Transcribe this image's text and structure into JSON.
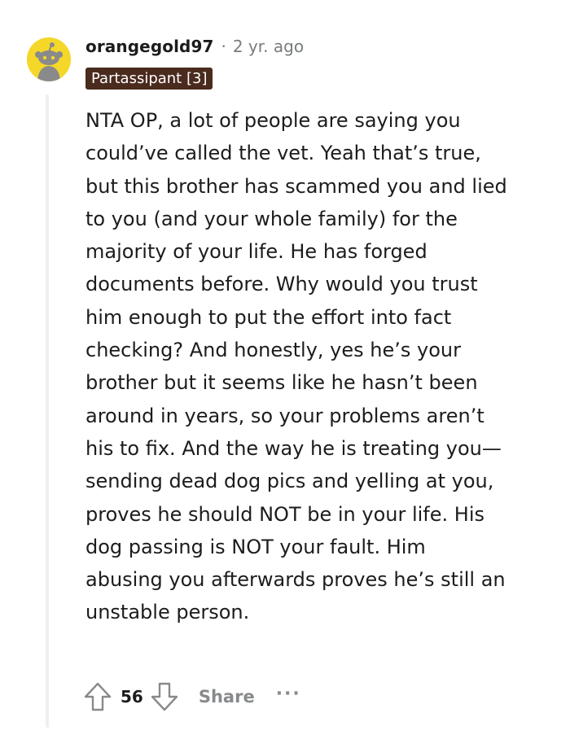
{
  "comment": {
    "username": "orangegold97",
    "separator": "·",
    "timestamp": "2 yr. ago",
    "flair": "Partassipant [3]",
    "body": "NTA OP, a lot of people are saying you could’ve called the vet. Yeah that’s true, but this brother has scammed you and lied to you (and your whole family) for the majority of your life. He has forged documents before. Why would you trust him enough to put the effort into fact checking? And honestly, yes he’s your brother but it seems like he hasn’t been around in years, so your problems aren’t his to fix. And the way he is treating you—sending dead dog pics and yelling at you, proves he should NOT be in your life. His dog passing is NOT your fault. Him abusing you afterwards proves he’s still an unstable person.",
    "score": "56",
    "share_label": "Share",
    "more_label": "···"
  },
  "avatar": {
    "icon": "snoo-avatar-icon",
    "background": "#f5d72a"
  },
  "colors": {
    "flair_bg": "#4a2b1e",
    "muted": "#787c7e",
    "text": "#1c1c1c",
    "thread_line": "#edeff1"
  }
}
